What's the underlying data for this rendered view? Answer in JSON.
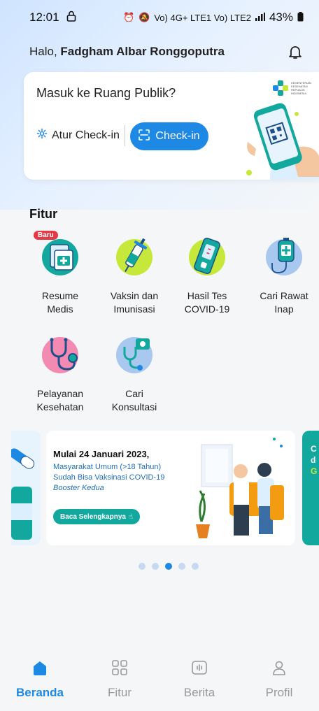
{
  "status_bar": {
    "time": "12:01",
    "signal_text": "Vo) 4G+ LTE1 Vo) LTE2",
    "battery": "43%"
  },
  "header": {
    "greeting_prefix": "Halo, ",
    "user_name": "Fadgham Albar Ronggoputra"
  },
  "checkin_card": {
    "title": "Masuk ke Ruang Publik?",
    "logo_text": "KEMENTERIAN KESEHATAN REPUBLIK INDONESIA",
    "atur_label": "Atur Check-in",
    "checkin_label": "Check-in"
  },
  "fitur": {
    "section_title": "Fitur",
    "badge_new": "Baru",
    "items": [
      {
        "line1": "Resume",
        "line2": "Medis",
        "icon": "medical-record-icon"
      },
      {
        "line1": "Vaksin dan",
        "line2": "Imunisasi",
        "icon": "syringe-icon"
      },
      {
        "line1": "Hasil Tes",
        "line2": "COVID-19",
        "icon": "test-kit-icon"
      },
      {
        "line1": "Cari Rawat",
        "line2": "Inap",
        "icon": "iv-bag-icon"
      },
      {
        "line1": "Pelayanan",
        "line2": "Kesehatan",
        "icon": "stethoscope-icon"
      },
      {
        "line1": "Cari",
        "line2": "Konsultasi",
        "icon": "consultation-icon"
      }
    ]
  },
  "banner": {
    "date": "Mulai 24 Januari 2023,",
    "line1": "Masyarakat Umum (>18 Tahun)",
    "line2": "Sudah Bisa Vaksinasi COVID-19",
    "line3": "Booster Kedua",
    "cta": "Baca Selengkapnya",
    "next_text1": "C",
    "next_text2": "d",
    "next_text3": "G"
  },
  "carousel": {
    "count": 5,
    "active_index": 2
  },
  "bottom_nav": [
    {
      "label": "Beranda",
      "icon": "home-icon",
      "active": true
    },
    {
      "label": "Fitur",
      "icon": "grid-icon",
      "active": false
    },
    {
      "label": "Berita",
      "icon": "news-icon",
      "active": false
    },
    {
      "label": "Profil",
      "icon": "user-icon",
      "active": false
    }
  ],
  "colors": {
    "primary": "#1e88e5",
    "teal": "#13a89e",
    "badge_red": "#e63946",
    "lime": "#c6e83a"
  }
}
